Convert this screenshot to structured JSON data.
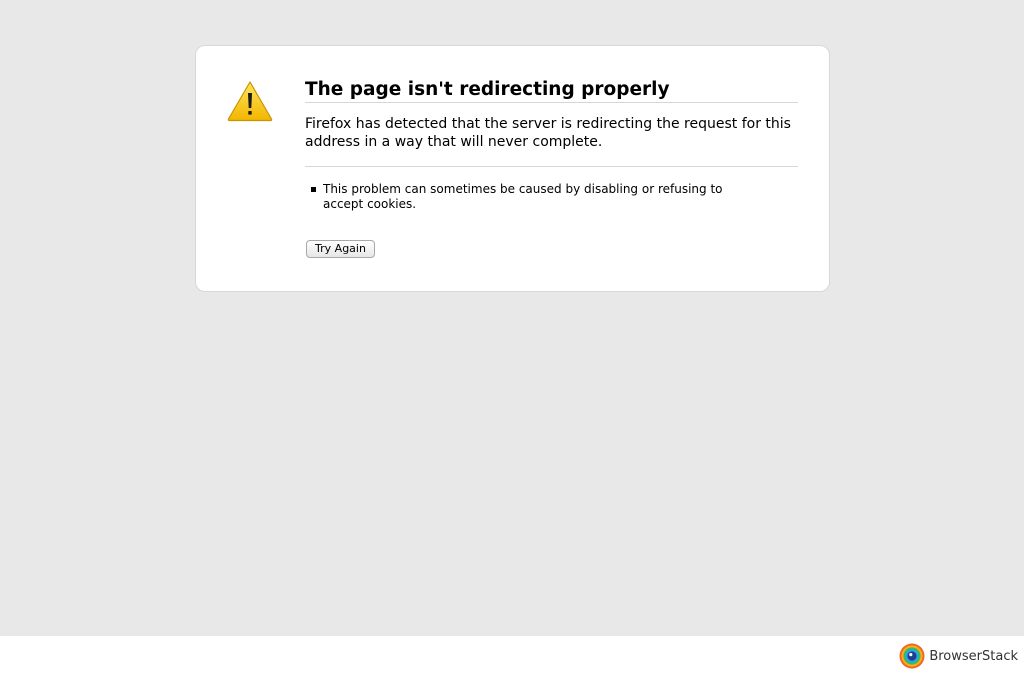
{
  "error": {
    "title": "The page isn't redirecting properly",
    "description": "Firefox has detected that the server is redirecting the request for this address in a way that will never complete.",
    "suggestions": [
      "This problem can sometimes be caused by disabling or refusing to accept cookies."
    ],
    "try_again_label": "Try Again",
    "icon": "warning-triangle-icon"
  },
  "footer": {
    "brand_name": "BrowserStack",
    "logo_icon": "browserstack-logo-icon"
  },
  "colors": {
    "page_background": "#e8e8e8",
    "box_background": "#ffffff",
    "warning_yellow": "#f5c400"
  }
}
